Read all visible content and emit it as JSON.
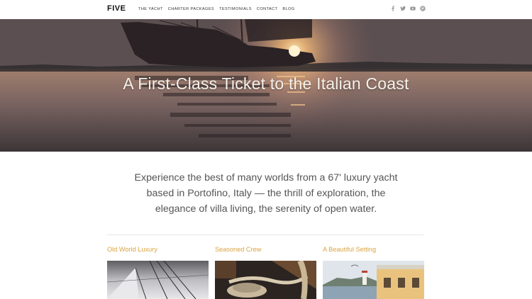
{
  "header": {
    "logo": "FIVE",
    "nav": [
      "THE YACHT",
      "CHARTER PACKAGES",
      "TESTIMONIALS",
      "CONTACT",
      "BLOG"
    ],
    "social": [
      "facebook-icon",
      "twitter-icon",
      "youtube-icon",
      "pinterest-icon"
    ]
  },
  "hero": {
    "title": "A First-Class Ticket to the Italian Coast"
  },
  "intro": {
    "line1": "Experience the best of many worlds from a 67' luxury yacht",
    "line2": "based in Portofino, Italy — the thrill of exploration, the",
    "line3": "elegance of villa living, the serenity of open water."
  },
  "features": [
    {
      "title": "Old World Luxury"
    },
    {
      "title": "Seasoned Crew"
    },
    {
      "title": "A Beautiful Setting"
    }
  ],
  "colors": {
    "accent": "#d9a441",
    "text": "#555555",
    "header_bg": "#ffffff"
  }
}
